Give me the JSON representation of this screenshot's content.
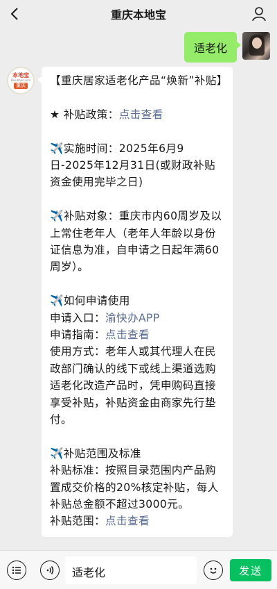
{
  "header": {
    "title": "重庆本地宝"
  },
  "self_message": {
    "text": "适老化"
  },
  "bot_avatar": {
    "line1": "本地宝",
    "line2": "Bendibao.com",
    "line3": "重庆"
  },
  "message": {
    "title": "【重庆居家适老化产品“焕新”补贴】",
    "policy_prefix": "★ 补贴政策：",
    "policy_link": "点击查看",
    "plane_icon": "✈️",
    "time_text": "实施时间：2025年6月9日-2025年12月31日(或财政补贴资金使用完毕之日)",
    "target_text": "补贴对象：重庆市内60周岁及以上常住老年人（老年人年龄以身份证信息为准，自申请之日起年满60周岁）。",
    "howto_title": "如何申请使用",
    "entry_prefix": "申请入口：",
    "entry_link": "渝快办APP",
    "guide_prefix": "申请指南：",
    "guide_link": "点击查看",
    "usage_text": "使用方式：老年人或其代理人在民政部门确认的线下或线上渠道选购适老化改造产品时，凭申购码直接享受补贴，补贴资金由商家先行垫付。",
    "scope_title": "补贴范围及标准",
    "standard_text": "补贴标准：按照目录范围内产品购置成交价格的20%核定补贴，每人补贴总金额不超过3000元。",
    "range_prefix": "补贴范围：",
    "range_link": "点击查看"
  },
  "input": {
    "value": "适老化"
  },
  "send_label": "发送",
  "icons": {
    "back": "back-chevron-icon",
    "user": "user-profile-icon",
    "menu": "menu-list-icon",
    "voice": "voice-icon",
    "emoji": "emoji-icon"
  }
}
